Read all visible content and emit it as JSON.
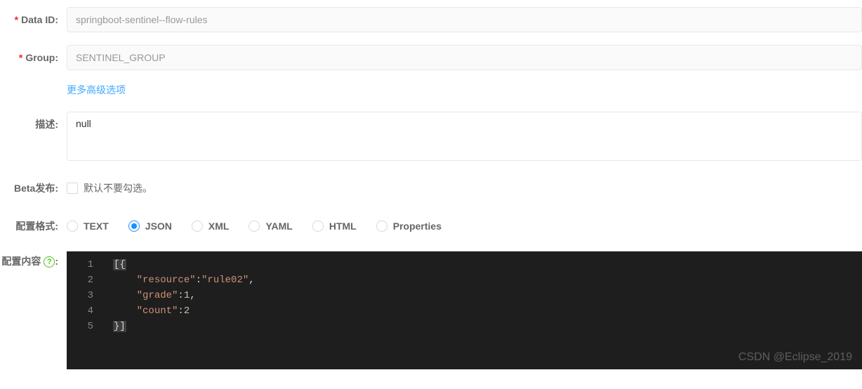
{
  "fields": {
    "dataId": {
      "label": "Data ID:",
      "value": "springboot-sentinel--flow-rules",
      "required": true
    },
    "group": {
      "label": "Group:",
      "value": "SENTINEL_GROUP",
      "required": true
    },
    "advanced": {
      "link": "更多高级选项"
    },
    "description": {
      "label": "描述:",
      "value": "null"
    },
    "beta": {
      "label": "Beta发布:",
      "checkboxLabel": "默认不要勾选。"
    },
    "format": {
      "label": "配置格式:",
      "options": {
        "text": "TEXT",
        "json": "JSON",
        "xml": "XML",
        "yaml": "YAML",
        "html": "HTML",
        "properties": "Properties"
      },
      "selected": "json"
    },
    "content": {
      "label": "配置内容",
      "helpChar": "?",
      "colon": ":",
      "lines": {
        "l1": "1",
        "l2": "2",
        "l3": "3",
        "l4": "4",
        "l5": "5"
      },
      "code": {
        "line1_open": "[{",
        "line2_indent": "    ",
        "line2_key": "\"resource\"",
        "line2_colon": ":",
        "line2_val": "\"rule02\"",
        "line2_comma": ",",
        "line3_indent": "    ",
        "line3_key": "\"grade\"",
        "line3_colon": ":",
        "line3_val": "1",
        "line3_comma": ",",
        "line4_indent": "    ",
        "line4_key": "\"count\"",
        "line4_colon": ":",
        "line4_val": "2",
        "line5_close": "}]"
      }
    }
  },
  "watermark": "CSDN @Eclipse_2019"
}
